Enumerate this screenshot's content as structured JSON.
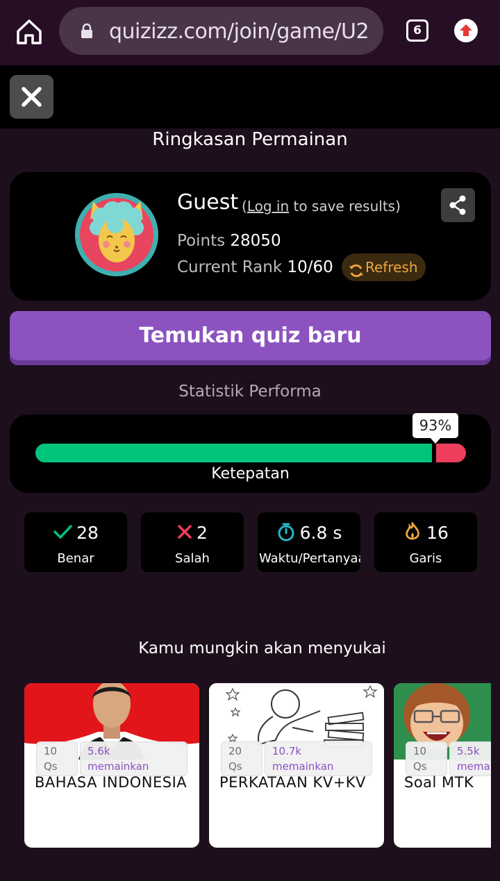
{
  "browser": {
    "url": "quizizz.com/join/game/U2",
    "tab_count": "6"
  },
  "summary": {
    "title": "Ringkasan Permainan"
  },
  "player": {
    "name": "Guest",
    "login_prefix": "(",
    "login_link": "Log in",
    "login_suffix": " to save results)",
    "points_label": "Points",
    "points_value": "28050",
    "rank_label": "Current Rank",
    "rank_value": "10/60",
    "refresh_label": "Refresh"
  },
  "actions": {
    "find_quiz_label": "Temukan quiz baru"
  },
  "stats": {
    "title": "Statistik Performa",
    "accuracy_percent": 93,
    "accuracy_text": "93%",
    "accuracy_label": "Ketepatan",
    "cards": [
      {
        "value": "28",
        "label": "Benar",
        "icon": "check-icon",
        "color": "#00c47a"
      },
      {
        "value": "2",
        "label": "Salah",
        "icon": "cross-icon",
        "color": "#ee3d5d"
      },
      {
        "value": "6.8 s",
        "label": "Waktu/Pertanyaan",
        "icon": "stopwatch-icon",
        "color": "#23b6c8"
      },
      {
        "value": "16",
        "label": "Garis",
        "icon": "flame-icon",
        "color": "#f1a63a"
      }
    ]
  },
  "recommendations": {
    "title": "Kamu mungkin akan menyukai",
    "quizzes": [
      {
        "qs_count": "10",
        "qs_label": "Qs",
        "plays_count": "5.6k",
        "plays_label": "memainkan",
        "title": "BAHASA INDONESIA"
      },
      {
        "qs_count": "20",
        "qs_label": "Qs",
        "plays_count": "10.7k",
        "plays_label": "memainkan",
        "title": "PERKATAAN KV+KV"
      },
      {
        "qs_count": "10",
        "qs_label": "Qs",
        "plays_count": "5.5k",
        "plays_label": "memainkan",
        "title": "Soal MTK"
      }
    ]
  },
  "colors": {
    "accent_purple": "#8c53c0",
    "correct_green": "#00c47a",
    "wrong_red": "#ee3d5d",
    "refresh_orange": "#f1a63a"
  }
}
